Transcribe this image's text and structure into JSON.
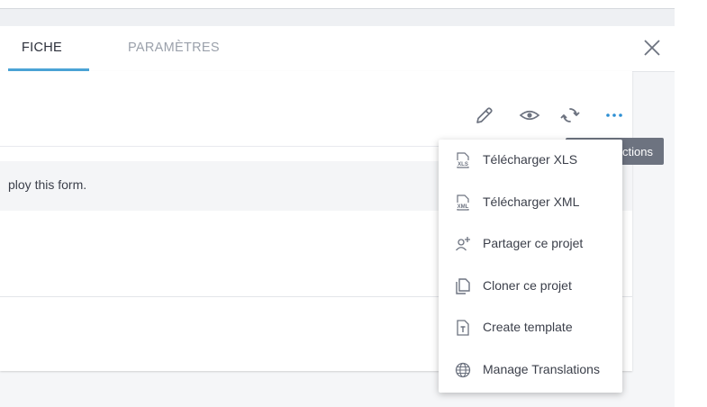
{
  "tabs": [
    {
      "label": "FICHE",
      "active": true
    },
    {
      "label": "PARAMÈTRES",
      "active": false
    }
  ],
  "header_icons": [
    "close-icon"
  ],
  "actions": {
    "icons": [
      "edit-icon",
      "eye-icon",
      "refresh-icon",
      "more-icon"
    ],
    "tooltip": "ctions"
  },
  "notice": {
    "text": "ploy this form."
  },
  "menu": {
    "items": [
      {
        "label": "Télécharger XLS",
        "icon": "xls-file-icon"
      },
      {
        "label": "Télécharger XML",
        "icon": "xml-file-icon"
      },
      {
        "label": "Partager ce projet",
        "icon": "add-user-icon"
      },
      {
        "label": "Cloner ce projet",
        "icon": "clone-icon"
      },
      {
        "label": "Create template",
        "icon": "template-icon"
      },
      {
        "label": "Manage Translations",
        "icon": "globe-icon"
      }
    ]
  },
  "colors": {
    "accent": "#4ba4d6",
    "more_icon": "#2d8fd3",
    "tooltip_bg": "#6d7380",
    "icon_gray": "#6d7380"
  }
}
